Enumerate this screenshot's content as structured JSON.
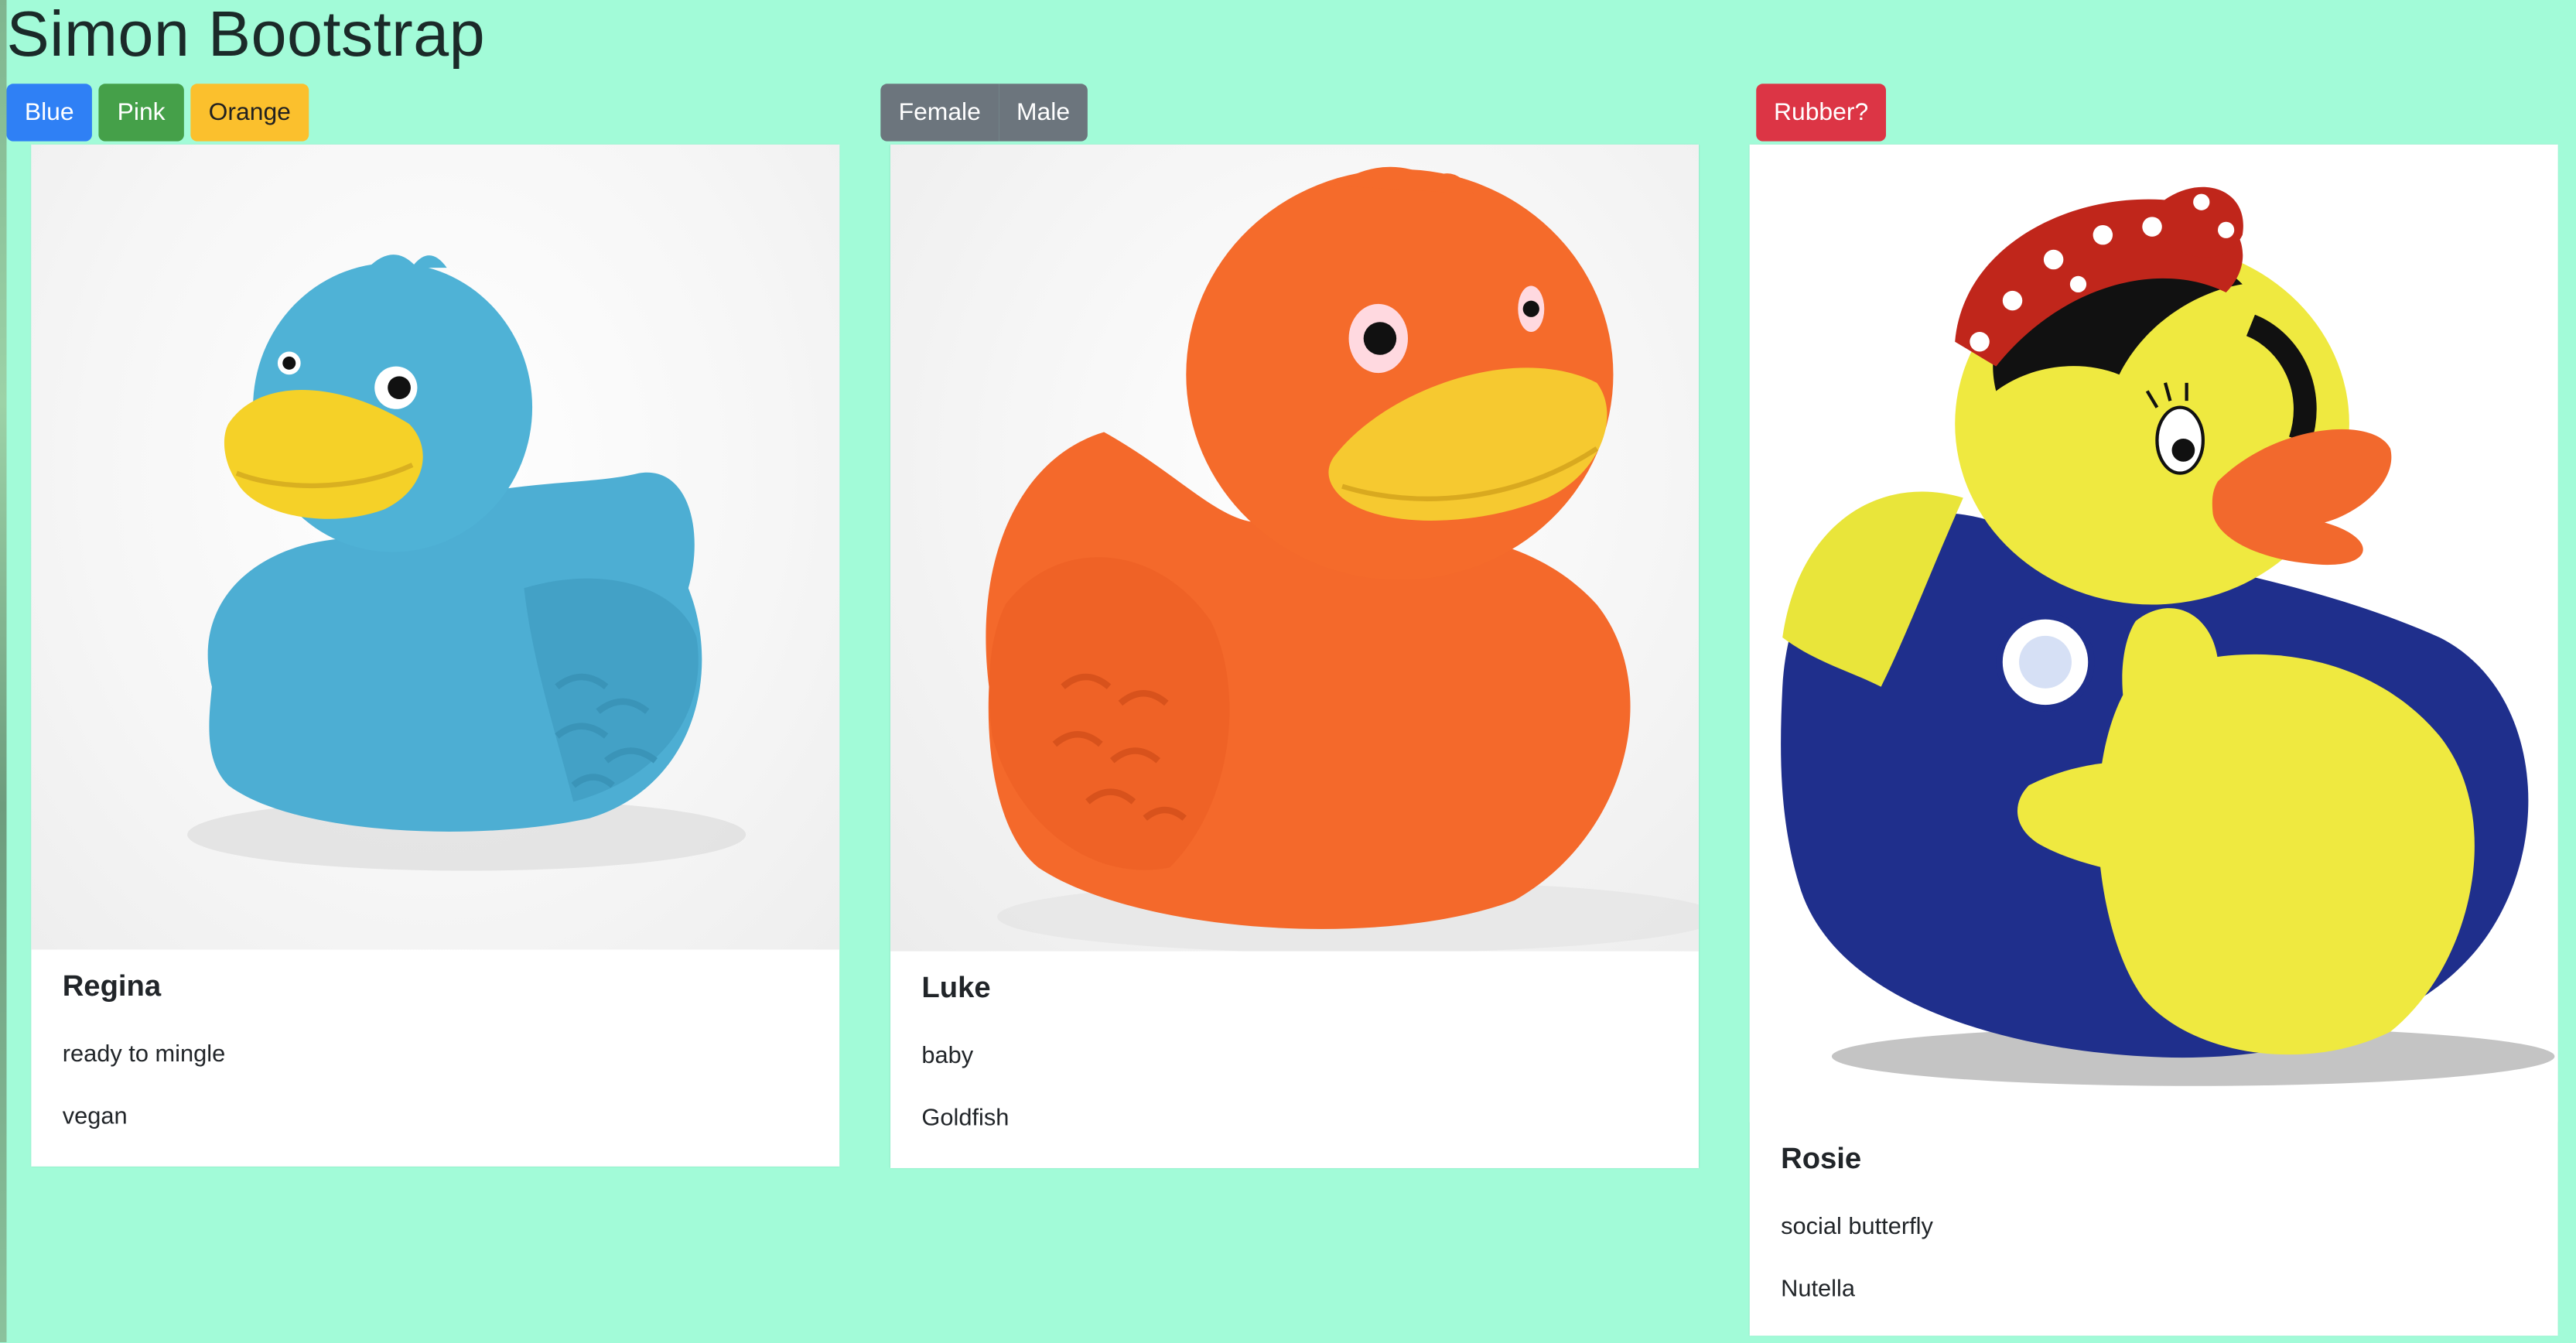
{
  "page": {
    "title": "Simon Bootstrap"
  },
  "color_buttons": {
    "blue": "Blue",
    "pink": "Pink",
    "orange": "Orange"
  },
  "gender_buttons": {
    "female": "Female",
    "male": "Male"
  },
  "rubber_button": {
    "label": "Rubber?"
  },
  "cards": [
    {
      "name": "Regina",
      "line1": "ready to mingle",
      "line2": "vegan",
      "image": "blue-rubber-duck"
    },
    {
      "name": "Luke",
      "line1": "baby",
      "line2": "Goldfish",
      "image": "orange-rubber-duck"
    },
    {
      "name": "Rosie",
      "line1": "social butterfly",
      "line2": "Nutella",
      "image": "rosie-riveter-rubber-duck"
    }
  ],
  "colors": {
    "background": "#a2fbd8",
    "blue_button": "#2f80f5",
    "pink_button": "#45a049",
    "orange_button": "#fbc02d",
    "gender_buttons": "#6c757d",
    "rubber_button": "#dc3545"
  }
}
